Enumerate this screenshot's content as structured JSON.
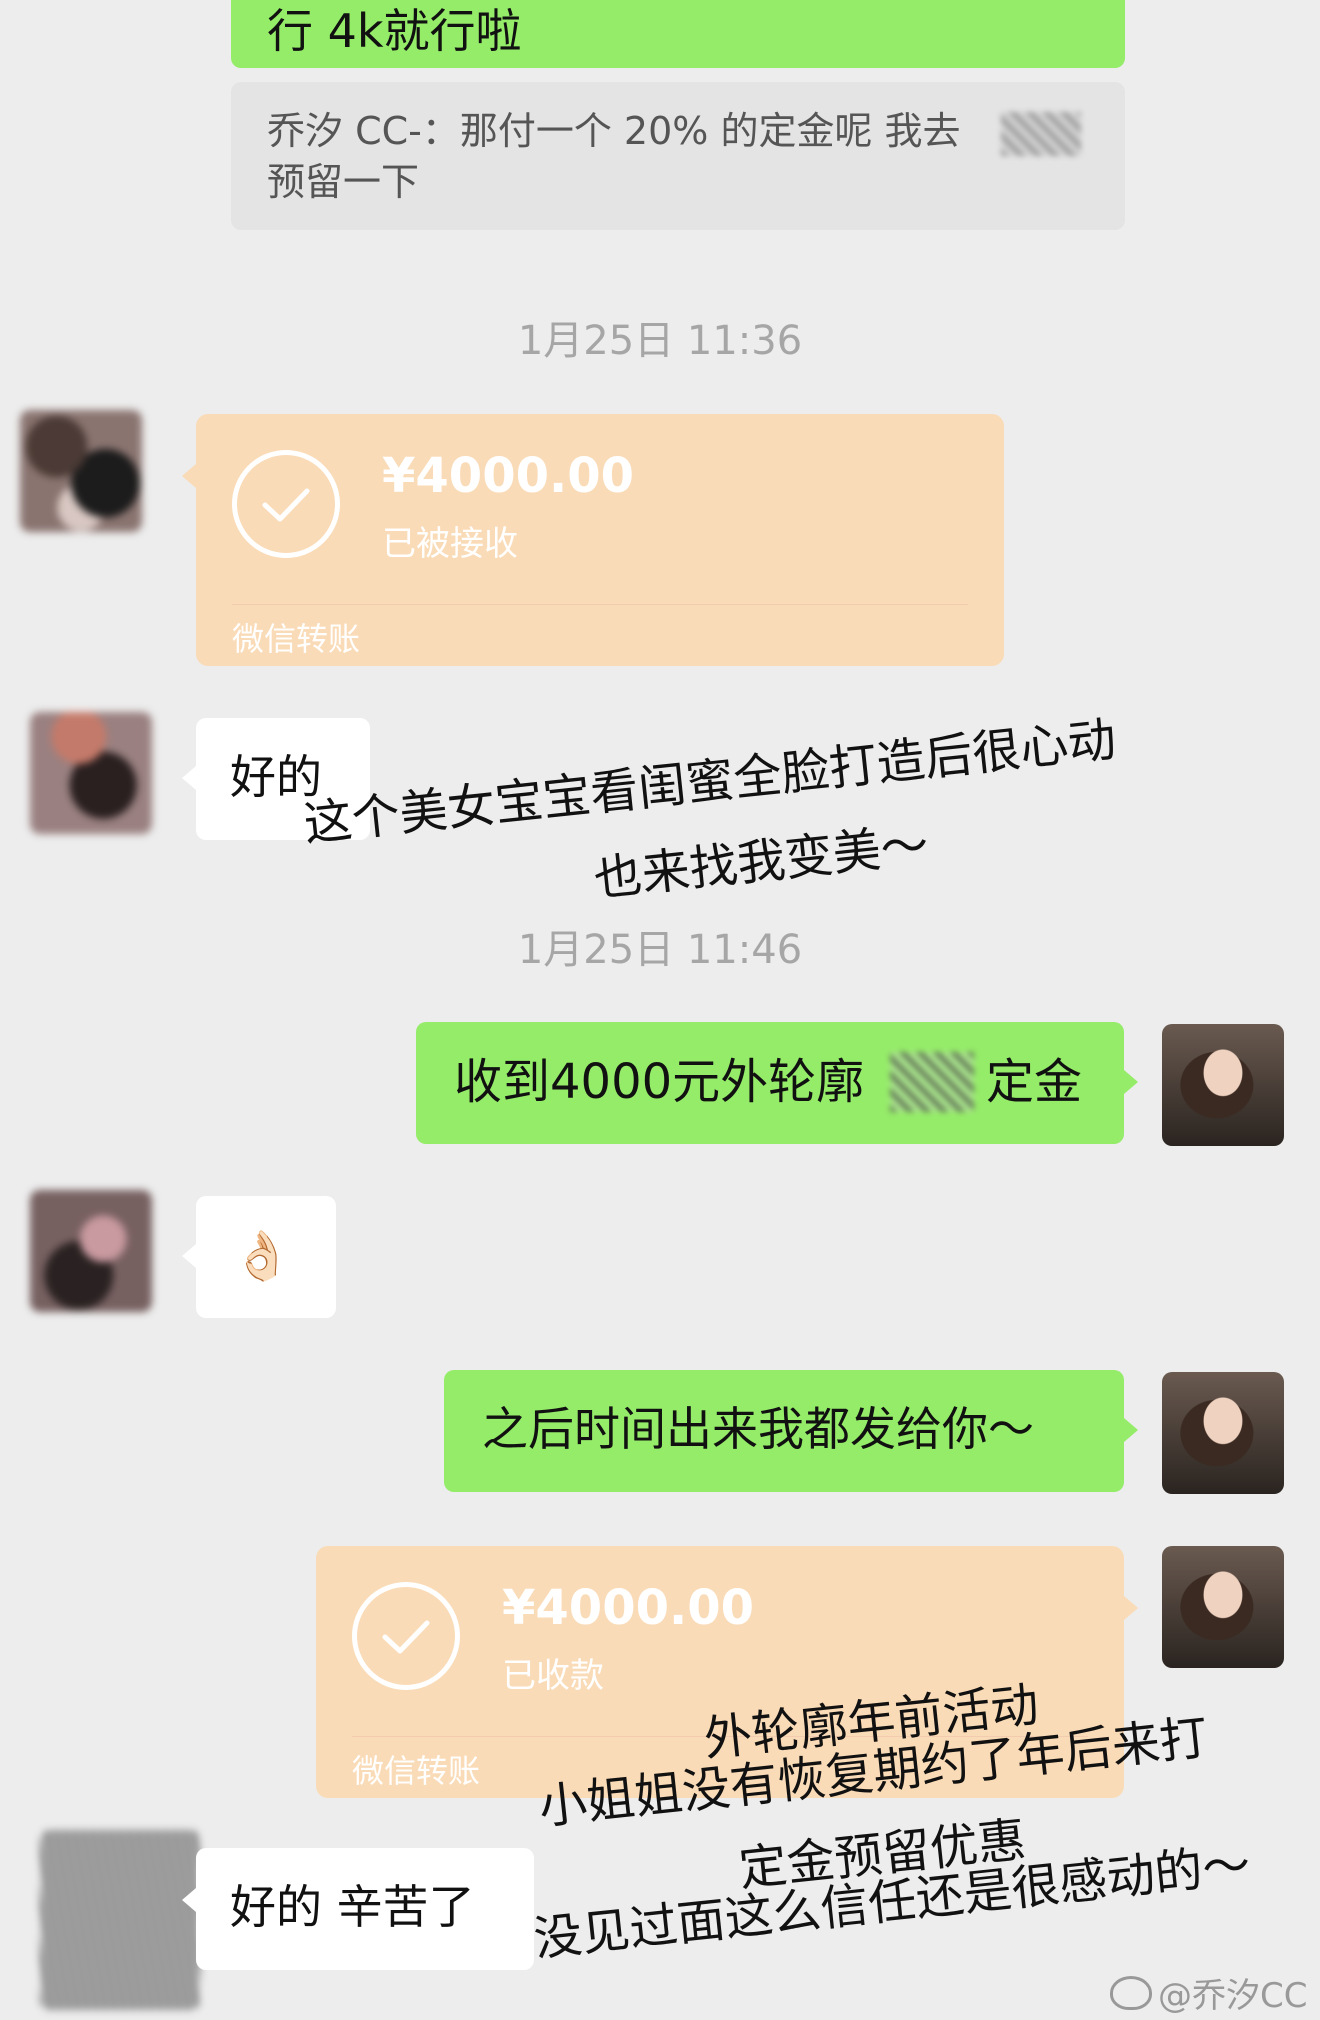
{
  "messages": {
    "top_partial": "行 4k就行啦",
    "quote_text_line1": "乔汐 CC-：那付一个 20% 的定金呢 我去",
    "quote_text_line2": "预留一下",
    "timestamp1": "1月25日 11:36",
    "transfer1": {
      "amount": "¥4000.00",
      "status": "已被接收",
      "brand": "微信转账"
    },
    "reply1": "好的",
    "timestamp2": "1月25日 11:46",
    "sent1_prefix": "收到4000元外轮廓",
    "sent1_suffix": "定金",
    "emoji_reply": "👌🏻",
    "sent2": "之后时间出来我都发给你～",
    "transfer2": {
      "amount": "¥4000.00",
      "status": "已收款",
      "brand": "微信转账"
    },
    "reply2": "好的 辛苦了"
  },
  "annotations": {
    "note1_line1": "这个美女宝宝看闺蜜全脸打造后很心动",
    "note1_line2": "也来找我变美～",
    "note2_line1": "外轮廓年前活动",
    "note2_line2": "小姐姐没有恢复期约了年后来打",
    "note2_line3": "定金预留优惠",
    "note2_line4": "没见过面这么信任还是很感动的～"
  },
  "watermark": "@乔汐CC",
  "colors": {
    "background": "#ededed",
    "green_bubble": "#95ec69",
    "white_bubble": "#ffffff",
    "transfer_bubble": "#fadbb7",
    "timestamp": "#a6a6a6"
  }
}
